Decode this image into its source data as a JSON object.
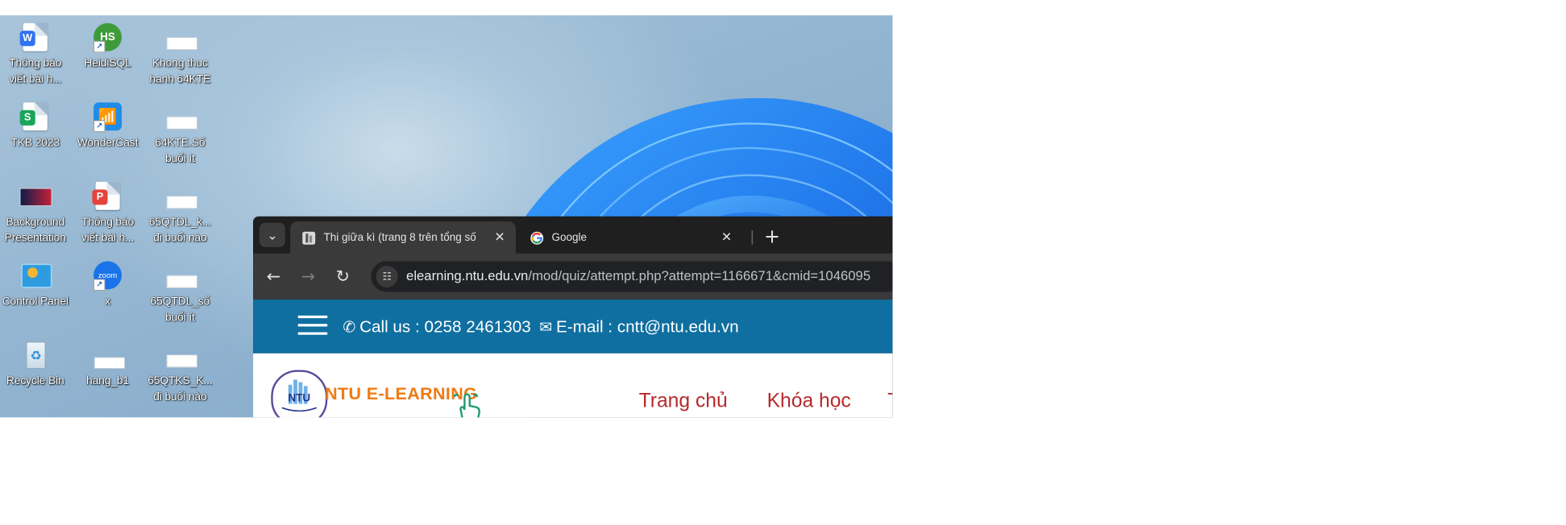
{
  "desktop": {
    "icons": [
      {
        "label_line1": "Thông báo",
        "label_line2": "viết bài h...",
        "icon": "wps-writer-icon"
      },
      {
        "label_line1": "HeidiSQL",
        "label_line2": "",
        "icon": "heidisql-icon"
      },
      {
        "label_line1": "Khong thuc",
        "label_line2": "hanh 64KTE",
        "icon": "spreadsheet-file-icon"
      },
      {
        "label_line1": "TKB 2023",
        "label_line2": "",
        "icon": "wps-sheet-icon"
      },
      {
        "label_line1": "WonderCast",
        "label_line2": "",
        "icon": "wondercast-icon"
      },
      {
        "label_line1": "64KTE.Số",
        "label_line2": "buổi ít",
        "icon": "spreadsheet-file-icon"
      },
      {
        "label_line1": "Background",
        "label_line2": "Presentation",
        "icon": "presentation-file-icon"
      },
      {
        "label_line1": "Thông báo",
        "label_line2": "viết bài h...",
        "icon": "wps-pdf-icon"
      },
      {
        "label_line1": "65QTDL_k...",
        "label_line2": "đi buổi nào",
        "icon": "spreadsheet-file-icon"
      },
      {
        "label_line1": "Control Panel",
        "label_line2": "",
        "icon": "control-panel-icon"
      },
      {
        "label_line1": "x",
        "label_line2": "",
        "icon": "zoom-icon"
      },
      {
        "label_line1": "65QTDL_số",
        "label_line2": "buổi ít",
        "icon": "spreadsheet-file-icon"
      },
      {
        "label_line1": "Recycle Bin",
        "label_line2": "",
        "icon": "recycle-bin-icon"
      },
      {
        "label_line1": "hang_b1",
        "label_line2": "",
        "icon": "image-file-icon"
      },
      {
        "label_line1": "65QTKS_K...",
        "label_line2": "đi buổi nào",
        "icon": "spreadsheet-file-icon"
      }
    ]
  },
  "browser": {
    "tab_search_icon": "chevron-down-icon",
    "tabs": [
      {
        "title": "Thi giữa kì (trang 8 trên tổng số",
        "icon": "moodle-quiz-favicon",
        "close": "✕",
        "active": true
      },
      {
        "title": "Google",
        "icon": "google-favicon",
        "close": "✕",
        "active": false
      }
    ],
    "new_tab": "+",
    "toolbar": {
      "back": "←",
      "forward": "→",
      "reload": "↻",
      "site_info_icon": "tune-icon",
      "url_host": "elearning.ntu.edu.vn",
      "url_path": "/mod/quiz/attempt.php?attempt=1166671&cmid=1046095"
    }
  },
  "site": {
    "call_text": "Call us : 0258 2461303",
    "email_text": "E-mail : cntt@ntu.edu.vn",
    "brand": "NTU E-LEARNING",
    "logo_text": "NTU",
    "nav": [
      "Trang chủ",
      "Khóa học",
      "T"
    ],
    "colors": {
      "infobar": "#0f6fa0",
      "brand": "#f07a13",
      "nav": "#b6292b"
    }
  }
}
